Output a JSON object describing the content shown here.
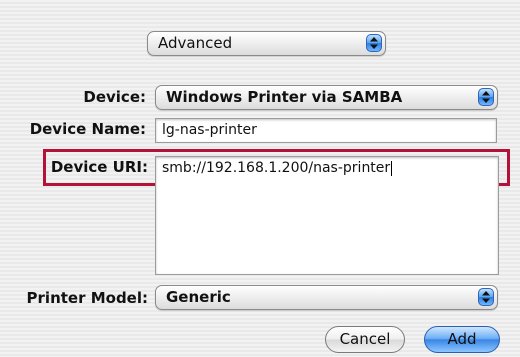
{
  "mode_popup": {
    "value": "Advanced"
  },
  "device": {
    "label": "Device:",
    "value": "Windows Printer via SAMBA"
  },
  "device_name": {
    "label": "Device Name:",
    "value": "lg-nas-printer"
  },
  "device_uri": {
    "label": "Device URI:",
    "value": "smb://192.168.1.200/nas-printer"
  },
  "printer_model": {
    "label": "Printer Model:",
    "value": "Generic"
  },
  "buttons": {
    "cancel": "Cancel",
    "add": "Add"
  },
  "colors": {
    "highlight": "#b5123a",
    "accent": "#3a86e6"
  },
  "icons": {
    "popup_arrows": "up-down-arrows-icon"
  }
}
